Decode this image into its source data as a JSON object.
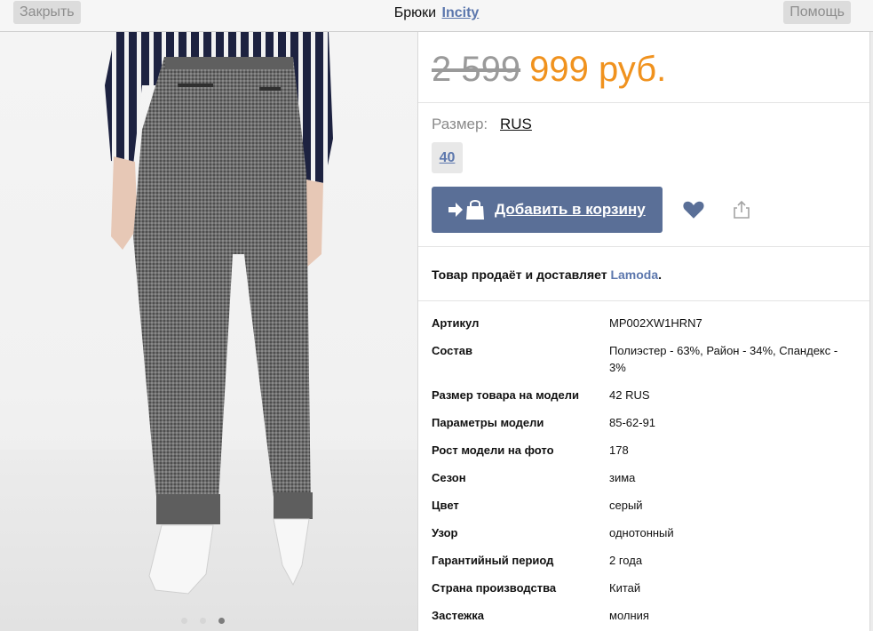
{
  "topbar": {
    "close_label": "Закрыть",
    "title": "Брюки",
    "brand": "Incity",
    "help_label": "Помощь"
  },
  "gallery": {
    "total_images": 3,
    "active_index": 2
  },
  "product": {
    "old_price": "2 599",
    "new_price": "999 руб.",
    "size_label": "Размер:",
    "size_system": "RUS",
    "size_options": [
      "40"
    ],
    "add_to_cart_label": "Добавить в корзину",
    "seller_text": "Товар продаёт и доставляет",
    "seller_name": "Lamoda",
    "seller_end": "."
  },
  "colors": {
    "accent_orange": "#f0921e",
    "brand_blue": "#5c77ad",
    "button_blue": "#5a6f97"
  },
  "specs": [
    {
      "key": "Артикул",
      "value": "MP002XW1HRN7"
    },
    {
      "key": "Состав",
      "value": "Полиэстер - 63%, Район - 34%, Спандекс - 3%"
    },
    {
      "key": "Размер товара на модели",
      "value": "42 RUS"
    },
    {
      "key": "Параметры модели",
      "value": "85-62-91"
    },
    {
      "key": "Рост модели на фото",
      "value": "178"
    },
    {
      "key": "Сезон",
      "value": "зима"
    },
    {
      "key": "Цвет",
      "value": "серый"
    },
    {
      "key": "Узор",
      "value": "однотонный"
    },
    {
      "key": "Гарантийный период",
      "value": "2 года"
    },
    {
      "key": "Страна производства",
      "value": "Китай"
    },
    {
      "key": "Застежка",
      "value": "молния"
    }
  ]
}
